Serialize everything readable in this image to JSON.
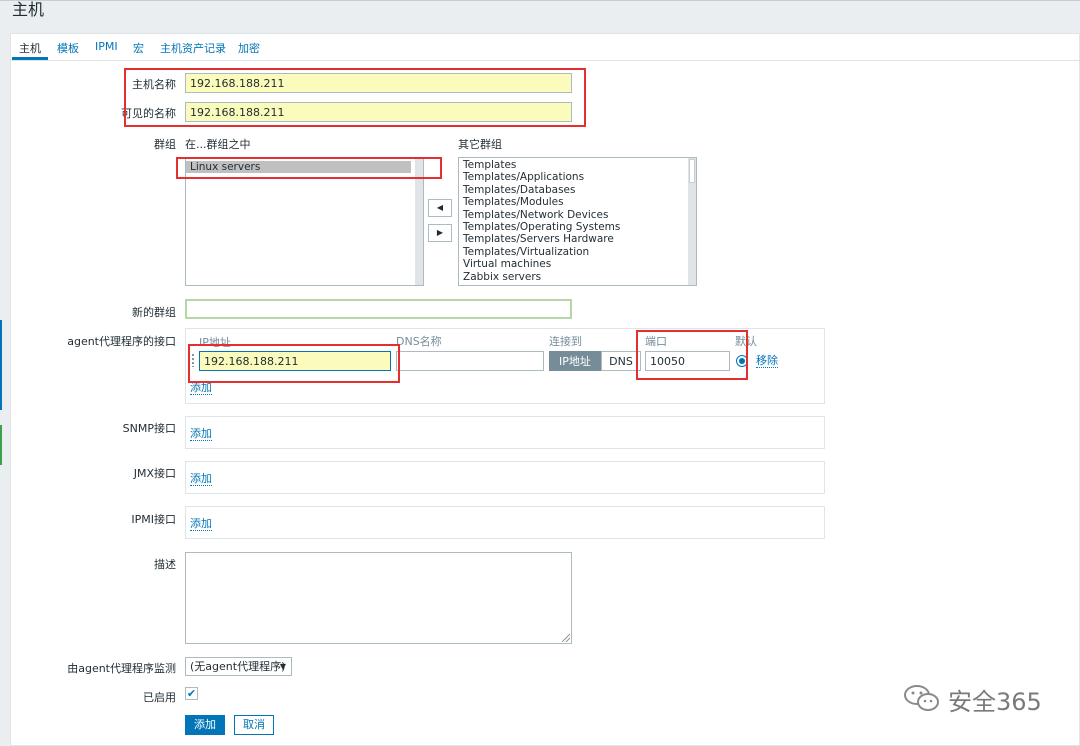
{
  "page": {
    "title": "主机"
  },
  "tabs": [
    {
      "label": "主机"
    },
    {
      "label": "模板"
    },
    {
      "label": "IPMI"
    },
    {
      "label": "宏"
    },
    {
      "label": "主机资产记录"
    },
    {
      "label": "加密"
    }
  ],
  "form": {
    "host_name": {
      "label": "主机名称",
      "value": "192.168.188.211"
    },
    "visible_name": {
      "label": "可见的名称",
      "value": "192.168.188.211"
    },
    "groups": {
      "label": "群组",
      "in_groups_label": "在...群组之中",
      "other_groups_label": "其它群组",
      "in_groups": [
        "Linux servers"
      ],
      "other_groups": [
        "Templates",
        "Templates/Applications",
        "Templates/Databases",
        "Templates/Modules",
        "Templates/Network Devices",
        "Templates/Operating Systems",
        "Templates/Servers Hardware",
        "Templates/Virtualization",
        "Virtual machines",
        "Zabbix servers"
      ],
      "move_left": "◀",
      "move_right": "▶"
    },
    "new_group": {
      "label": "新的群组",
      "value": ""
    },
    "agent_interfaces": {
      "label": "agent代理程序的接口",
      "col_ip": "IP地址",
      "col_dns": "DNS名称",
      "col_connect": "连接到",
      "col_port": "端口",
      "col_default": "默认",
      "ip_value": "192.168.188.211",
      "dns_value": "",
      "connect_ip": "IP地址",
      "connect_dns": "DNS",
      "port_value": "10050",
      "remove": "移除",
      "add": "添加"
    },
    "snmp": {
      "label": "SNMP接口",
      "add": "添加"
    },
    "jmx": {
      "label": "JMX接口",
      "add": "添加"
    },
    "ipmi": {
      "label": "IPMI接口",
      "add": "添加"
    },
    "description": {
      "label": "描述",
      "value": ""
    },
    "monitored_by": {
      "label": "由agent代理程序监测",
      "value": "(无agent代理程序)"
    },
    "enabled": {
      "label": "已启用",
      "checked": true,
      "mark": "✔"
    }
  },
  "buttons": {
    "add": "添加",
    "cancel": "取消"
  },
  "watermark": {
    "text": "安全365"
  },
  "colors": {
    "accent": "#0275b8",
    "highlight": "#e3302f",
    "input_highlight": "#fbfbbc"
  }
}
